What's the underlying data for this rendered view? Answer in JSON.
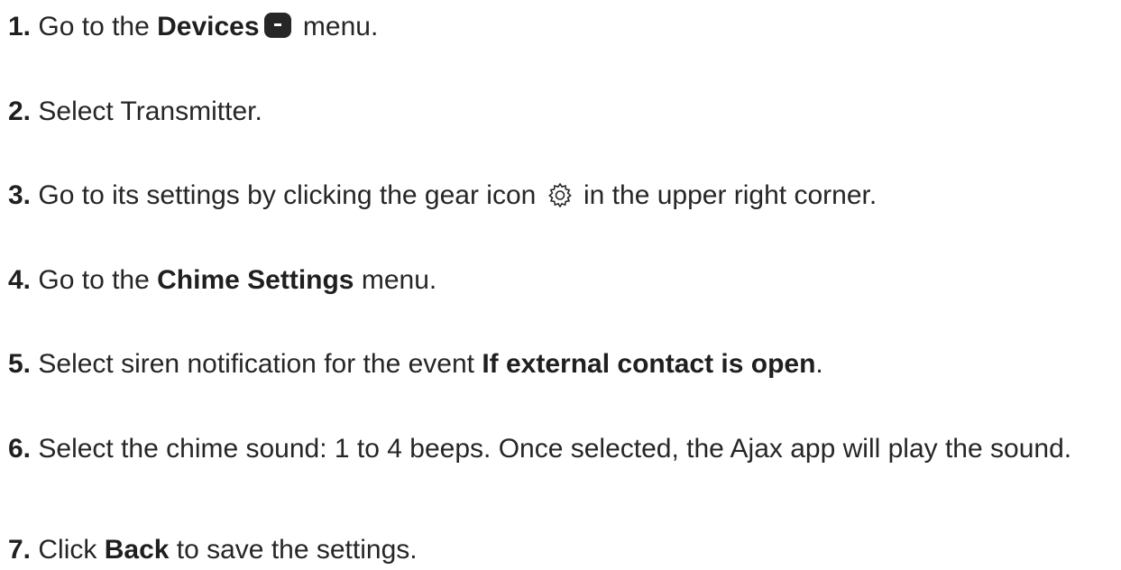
{
  "steps": [
    {
      "num": "1.",
      "pre": "Go to the ",
      "bold": "Devices",
      "icon": "devices-icon",
      "post": " menu."
    },
    {
      "num": "2.",
      "text": "Select Transmitter."
    },
    {
      "num": "3.",
      "pre": "Go to its settings by clicking the gear icon ",
      "icon": "gear-icon",
      "post": " in the upper right corner."
    },
    {
      "num": "4.",
      "pre": "Go to the ",
      "bold": "Chime Settings",
      "post": " menu."
    },
    {
      "num": "5.",
      "pre": "Select siren notification for the event ",
      "bold": "If external contact is open",
      "post": "."
    },
    {
      "num": "6.",
      "text": "Select the chime sound: 1 to 4 beeps. Once selected, the Ajax app will play the sound."
    },
    {
      "num": "7.",
      "pre": "Click ",
      "bold": "Back",
      "post": " to save the settings."
    }
  ]
}
